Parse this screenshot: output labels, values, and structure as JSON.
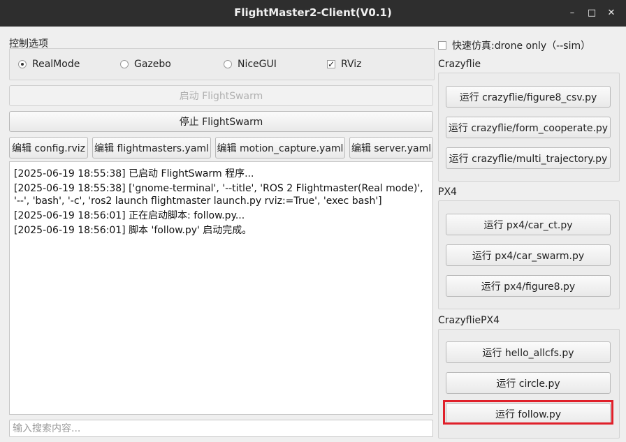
{
  "window": {
    "title": "FlightMaster2-Client(V0.1)",
    "minimize": "–",
    "maximize": "□",
    "close": "✕"
  },
  "control": {
    "title": "控制选项",
    "modes": [
      {
        "label": "RealMode",
        "selected": true
      },
      {
        "label": "Gazebo",
        "selected": false
      },
      {
        "label": "NiceGUI",
        "selected": false
      }
    ],
    "rviz": {
      "label": "RViz",
      "checked": true,
      "mark": "✓"
    }
  },
  "buttons": {
    "start": "启动 FlightSwarm",
    "stop": "停止 FlightSwarm",
    "edit_config": "编辑 config.rviz",
    "edit_flightmasters": "编辑 flightmasters.yaml",
    "edit_motion": "编辑 motion_capture.yaml",
    "edit_server": "编辑 server.yaml"
  },
  "log": [
    "[2025-06-19 18:55:38] 已启动 FlightSwarm 程序...",
    "[2025-06-19 18:55:38] ['gnome-terminal', '--title', 'ROS 2 Flightmaster(Real mode)', '--', 'bash', '-c', 'ros2 launch flightmaster launch.py rviz:=True', 'exec bash']",
    "[2025-06-19 18:56:01] 正在启动脚本: follow.py...",
    "[2025-06-19 18:56:01] 脚本 'follow.py' 启动完成。"
  ],
  "search": {
    "placeholder": "输入搜索内容..."
  },
  "sim": {
    "label": "快速仿真:drone only（--sim）",
    "checked": false
  },
  "crazyflie": {
    "title": "Crazyflie",
    "items": [
      "运行 crazyflie/figure8_csv.py",
      "运行 crazyflie/form_cooperate.py",
      "运行 crazyflie/multi_trajectory.py"
    ]
  },
  "px4": {
    "title": "PX4",
    "items": [
      "运行 px4/car_ct.py",
      "运行 px4/car_swarm.py",
      "运行 px4/figure8.py"
    ]
  },
  "crazyflie_px4": {
    "title": "CrazyfliePX4",
    "items": [
      "运行 hello_allcfs.py",
      "运行 circle.py",
      "运行 follow.py"
    ]
  }
}
